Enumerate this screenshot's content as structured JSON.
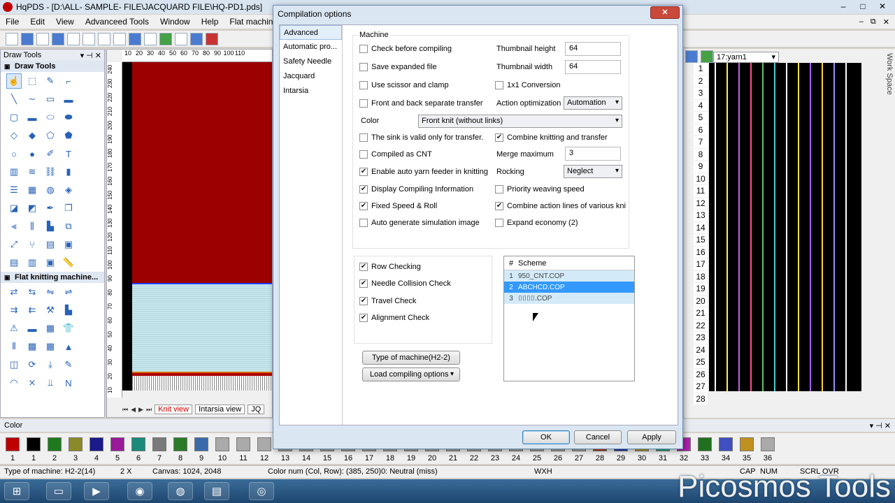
{
  "window": {
    "title": "HqPDS - [D:\\ALL- SAMPLE- FILE\\JACQUARD FILE\\HQ-PD1.pds]",
    "buttons": [
      "–",
      "□",
      "✕"
    ]
  },
  "menu": [
    "File",
    "Edit",
    "View",
    "Advanceed Tools",
    "Window",
    "Help",
    "Flat machine"
  ],
  "mdi_buttons": [
    "–",
    "⧉",
    "✕"
  ],
  "draw_tools": {
    "title": "Draw Tools",
    "section1": "Draw Tools",
    "section2": "Flat knitting machine..."
  },
  "canvas": {
    "ruler_top": [
      "10",
      "20",
      "30",
      "40",
      "50",
      "60",
      "70",
      "80",
      "90",
      "100",
      "110"
    ],
    "ruler_left": [
      "240",
      "230",
      "220",
      "210",
      "200",
      "190",
      "180",
      "170",
      "160",
      "150",
      "140",
      "130",
      "120",
      "110",
      "100",
      "90",
      "80",
      "70",
      "60",
      "50",
      "40",
      "30",
      "20",
      "10"
    ],
    "tabs": [
      "Knit view",
      "Intarsia view",
      "JQ"
    ]
  },
  "right_panel": {
    "yarn_select": "17:yarn1",
    "work_space": "Work Space",
    "row_numbers": [
      "1",
      "2",
      "3",
      "4",
      "5",
      "6",
      "7",
      "8",
      "9",
      "10",
      "11",
      "12",
      "13",
      "14",
      "15",
      "16",
      "17",
      "18",
      "19",
      "20",
      "21",
      "22",
      "23",
      "24",
      "25",
      "26",
      "27",
      "28"
    ],
    "yarn_colors": [
      "#ffffff",
      "#ffee55",
      "#c060e0",
      "#ff5090",
      "#60c060",
      "#40d0d0",
      "#ffffff",
      "#ffe040",
      "#a060ff",
      "#ffd030",
      "#9090ff",
      "#ffffff"
    ]
  },
  "dialog": {
    "title": "Compilation options",
    "close": "✕",
    "nav": [
      "Advanced",
      "Automatic pro...",
      "Safety Needle",
      "Jacquard",
      "Intarsia"
    ],
    "machine_legend": "Machine",
    "left_checks": [
      {
        "label": "Check before compiling",
        "checked": false
      },
      {
        "label": "Save expanded file",
        "checked": false
      },
      {
        "label": "Use scissor and clamp",
        "checked": false
      },
      {
        "label": "Front and back separate transfer",
        "checked": false
      }
    ],
    "thumb_height_label": "Thumbnail height",
    "thumb_height": "64",
    "thumb_width_label": "Thumbnail width",
    "thumb_width": "64",
    "conv_label": "1x1 Conversion",
    "action_opt_label": "Action optimization",
    "action_opt_value": "Automation",
    "color_label": "Color",
    "color_value": "Front knit (without links)",
    "checks2": [
      {
        "label": "The sink is valid only for transfer.",
        "checked": false
      },
      {
        "label": "Compiled as CNT",
        "checked": false
      },
      {
        "label": "Enable auto yarn feeder in knitting",
        "checked": true
      },
      {
        "label": "Display Compiling Information",
        "checked": true
      },
      {
        "label": "Fixed Speed & Roll",
        "checked": true
      },
      {
        "label": "Auto generate simulation image",
        "checked": false
      }
    ],
    "combine_label": "Combine knitting and transfer",
    "merge_label": "Merge maximum",
    "merge_value": "3",
    "rocking_label": "Rocking",
    "rocking_value": "Neglect",
    "priority_label": "Priority weaving speed",
    "combine_action_label": "Combine action lines of various kni",
    "expand_label": "Expand economy (2)",
    "checks3": [
      {
        "label": "Row Checking",
        "checked": true
      },
      {
        "label": "Needle Collision Check",
        "checked": true
      },
      {
        "label": "Travel Check",
        "checked": true
      },
      {
        "label": "Alignment Check",
        "checked": true
      }
    ],
    "type_button": "Type of machine(H2-2)",
    "load_button": "Load compiling options",
    "scheme": {
      "col_num": "#",
      "col_name": "Scheme",
      "rows": [
        {
          "num": "1",
          "name": "950_CNT.COP"
        },
        {
          "num": "2",
          "name": "ABCHCD.COP"
        },
        {
          "num": "3",
          "name": "⌷⌷⌷⌷.COP"
        }
      ]
    },
    "ok": "OK",
    "cancel": "Cancel",
    "apply": "Apply"
  },
  "colorbar": {
    "title": "Color",
    "numbers": [
      "1",
      "1",
      "2",
      "3",
      "4",
      "5",
      "6",
      "7",
      "8",
      "9",
      "10",
      "11",
      "12",
      "13",
      "14",
      "15",
      "16",
      "17",
      "18",
      "19",
      "20",
      "21",
      "22",
      "23",
      "24",
      "25",
      "26",
      "27",
      "28",
      "29",
      "30",
      "31",
      "32",
      "33",
      "34",
      "35",
      "36"
    ]
  },
  "status": {
    "machine": "Type of machine: H2-2(14)",
    "zoom": "2 X",
    "canvas": "Canvas: 1024, 2048",
    "color": "Color num  (Col, Row): (385, 250)0: Neutral (miss)",
    "wxh": "WXH",
    "caps": "CAP",
    "num": "NUM",
    "scrl": "SCRL",
    "ovr": "OVR"
  },
  "watermark": "Picosmos Tools"
}
